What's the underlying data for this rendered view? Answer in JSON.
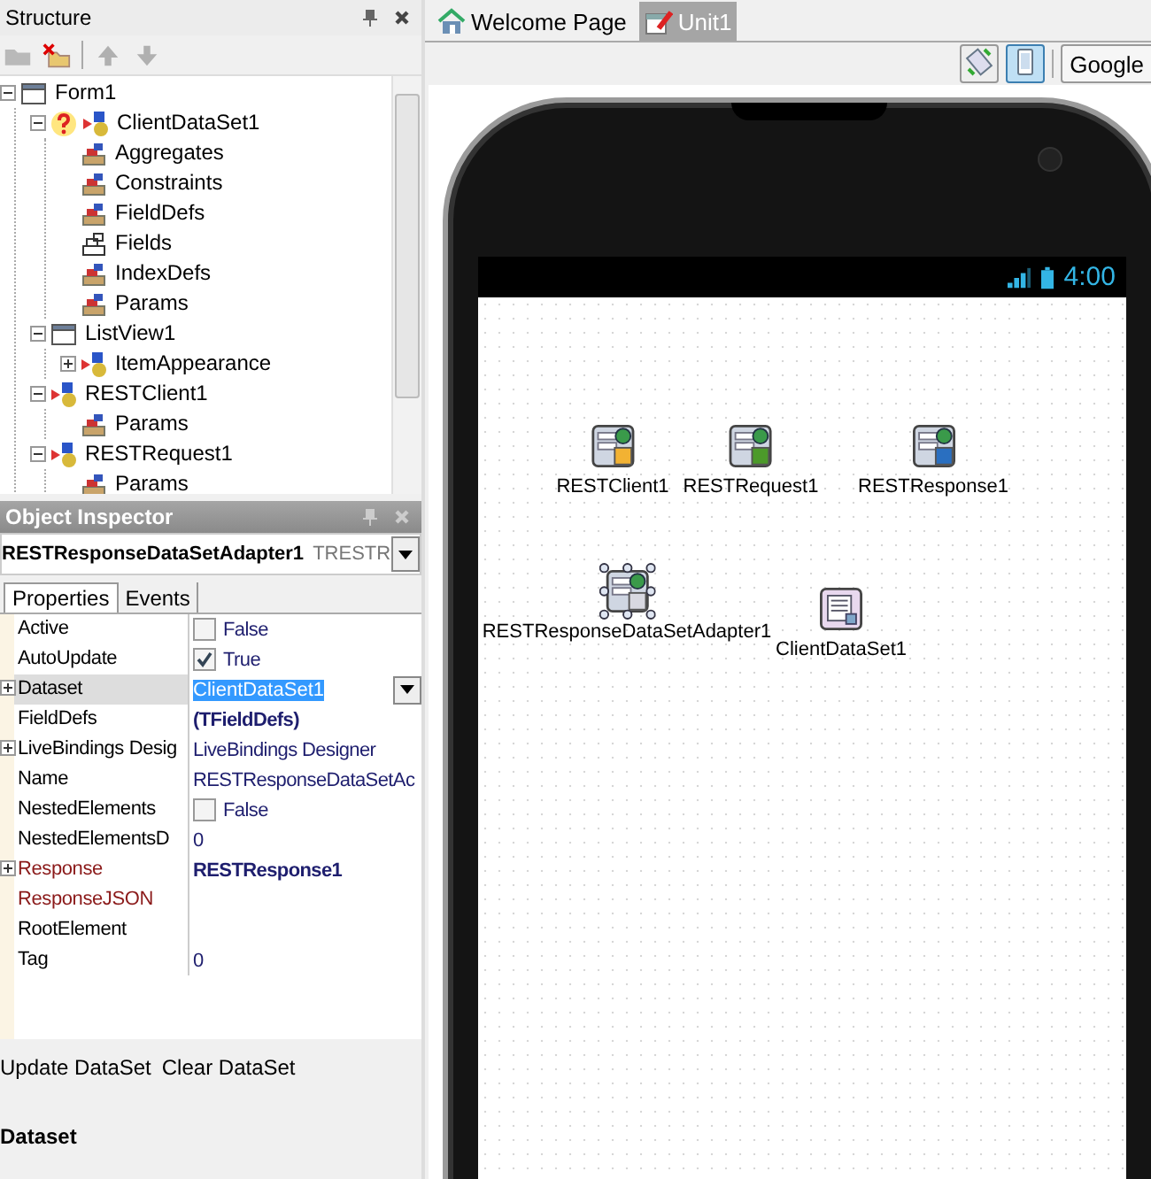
{
  "structure": {
    "title": "Structure",
    "tree": [
      {
        "label": "Form1",
        "kind": "form",
        "warning": false,
        "expanded": true,
        "children": [
          {
            "label": "ClientDataSet1",
            "kind": "component",
            "warning": true,
            "expanded": true,
            "children": [
              {
                "label": "Aggregates",
                "kind": "collection",
                "warning": false
              },
              {
                "label": "Constraints",
                "kind": "collection",
                "warning": false
              },
              {
                "label": "FieldDefs",
                "kind": "collection",
                "warning": false
              },
              {
                "label": "Fields",
                "kind": "fields",
                "warning": false
              },
              {
                "label": "IndexDefs",
                "kind": "collection",
                "warning": false
              },
              {
                "label": "Params",
                "kind": "collection",
                "warning": false
              }
            ]
          },
          {
            "label": "ListView1",
            "kind": "form",
            "warning": false,
            "expanded": true,
            "children": [
              {
                "label": "ItemAppearance",
                "kind": "component",
                "warning": false,
                "expanded": false
              }
            ]
          },
          {
            "label": "RESTClient1",
            "kind": "component",
            "warning": false,
            "expanded": true,
            "children": [
              {
                "label": "Params",
                "kind": "collection",
                "warning": false
              }
            ]
          },
          {
            "label": "RESTRequest1",
            "kind": "component",
            "warning": false,
            "expanded": true,
            "children": [
              {
                "label": "Params",
                "kind": "collection",
                "warning": false
              }
            ]
          }
        ]
      }
    ]
  },
  "object_inspector": {
    "title": "Object Inspector",
    "component_name": "RESTResponseDataSetAdapter1",
    "component_type": "TRESTR",
    "tabs": [
      {
        "label": "Properties",
        "selected": true
      },
      {
        "label": "Events",
        "selected": false
      }
    ],
    "properties": [
      {
        "name": "Active",
        "kind": "checkbox",
        "checked": false,
        "value": "False",
        "expandable": false,
        "linked": false,
        "selected": false
      },
      {
        "name": "AutoUpdate",
        "kind": "checkbox",
        "checked": true,
        "value": "True",
        "expandable": false,
        "linked": false,
        "selected": false
      },
      {
        "name": "Dataset",
        "kind": "combo",
        "value": "ClientDataSet1",
        "expandable": true,
        "linked": false,
        "selected": true
      },
      {
        "name": "FieldDefs",
        "kind": "bold",
        "value": "(TFieldDefs)",
        "expandable": false,
        "linked": false,
        "selected": false
      },
      {
        "name": "LiveBindings Desig",
        "kind": "text",
        "value": "LiveBindings Designer",
        "expandable": true,
        "linked": false,
        "selected": false
      },
      {
        "name": "Name",
        "kind": "text",
        "value": "RESTResponseDataSetAc",
        "expandable": false,
        "linked": false,
        "selected": false
      },
      {
        "name": "NestedElements",
        "kind": "checkbox",
        "checked": false,
        "value": "False",
        "expandable": false,
        "linked": false,
        "selected": false
      },
      {
        "name": "NestedElementsD",
        "kind": "text",
        "value": "0",
        "expandable": false,
        "linked": false,
        "selected": false
      },
      {
        "name": "Response",
        "kind": "bold",
        "value": "RESTResponse1",
        "expandable": true,
        "linked": true,
        "selected": false
      },
      {
        "name": "ResponseJSON",
        "kind": "text",
        "expandable": false,
        "linked": true,
        "selected": false
      },
      {
        "name": "RootElement",
        "kind": "text",
        "expandable": false,
        "linked": false,
        "selected": false
      },
      {
        "name": "Tag",
        "kind": "text",
        "value": "0",
        "expandable": false,
        "linked": false,
        "selected": false
      }
    ],
    "actions": [
      "Update DataSet",
      "Clear DataSet"
    ],
    "description_title": "Dataset"
  },
  "editor": {
    "tabs": [
      {
        "label": "Welcome Page",
        "kind": "home",
        "selected": false
      },
      {
        "label": "Unit1",
        "kind": "unit",
        "selected": true
      }
    ],
    "toolbar": {
      "buttons": [
        {
          "kind": "rotate",
          "selected": false
        },
        {
          "kind": "device",
          "selected": true
        }
      ],
      "device": "Google"
    },
    "device": {
      "time": "4:00",
      "components": [
        {
          "label": "RESTClient1",
          "kind": "client",
          "selected": false
        },
        {
          "label": "RESTRequest1",
          "kind": "request",
          "selected": false
        },
        {
          "label": "RESTResponse1",
          "kind": "response",
          "selected": false
        },
        {
          "label": "RESTResponseDataSetAdapter1",
          "kind": "adapter",
          "selected": true
        },
        {
          "label": "ClientDataSet1",
          "kind": "dataset",
          "selected": false
        }
      ]
    }
  }
}
